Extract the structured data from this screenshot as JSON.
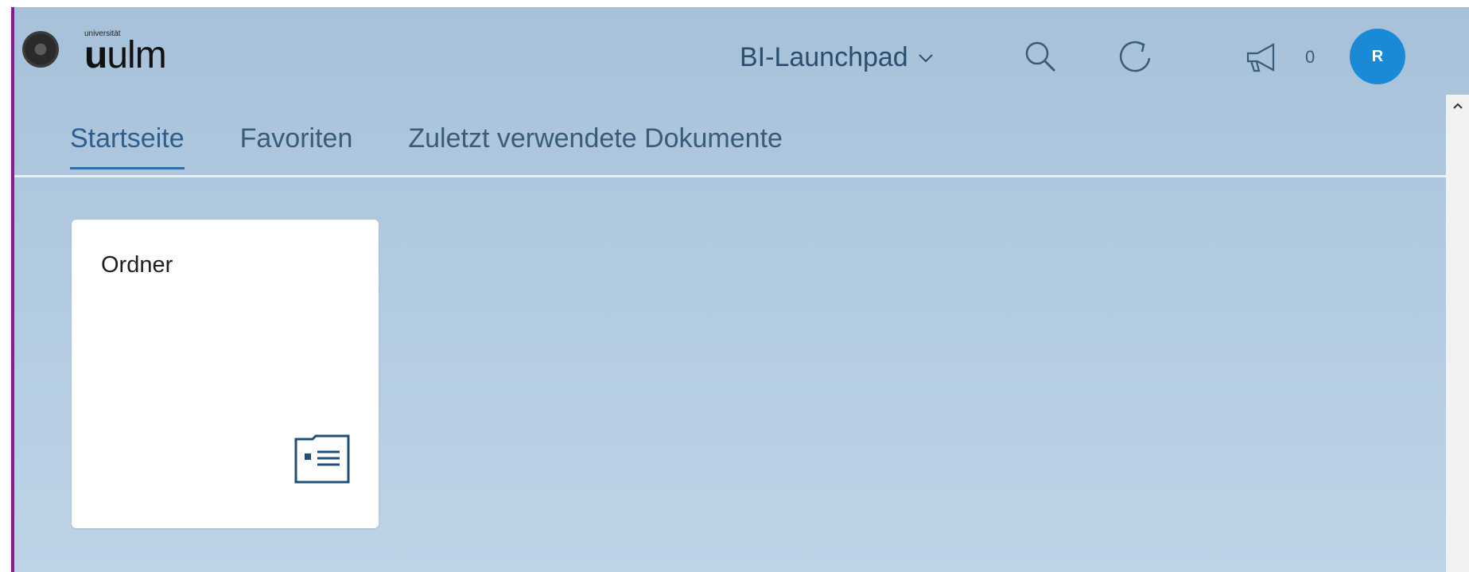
{
  "header": {
    "logo_small": "universität",
    "logo_bold": "u",
    "logo_rest": "ulm",
    "app_title": "BI-Launchpad",
    "notification_count": "0",
    "avatar_initial": "R"
  },
  "icons": {
    "logo": "university-emblem-icon",
    "app_menu": "chevron-down-icon",
    "search": "search-icon",
    "refresh": "refresh-icon",
    "notifications": "megaphone-icon",
    "tile": "folder-card-icon",
    "scroll_up": "chevron-up-icon"
  },
  "tabs": [
    {
      "label": "Startseite",
      "active": true
    },
    {
      "label": "Favoriten",
      "active": false
    },
    {
      "label": "Zuletzt verwendete Dokumente",
      "active": false
    }
  ],
  "tiles": [
    {
      "title": "Ordner"
    }
  ],
  "colors": {
    "accent": "#8b1a90",
    "avatar": "#1a8ad6",
    "tab_active": "#2e6fa7",
    "background": "#b0c9df"
  }
}
